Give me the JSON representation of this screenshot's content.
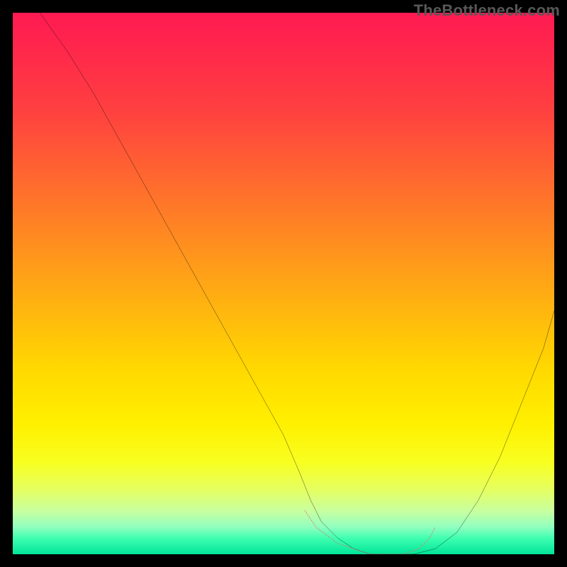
{
  "watermark": "TheBottleneck.com",
  "colors": {
    "background": "#000000",
    "curve_stroke": "#000000",
    "dot_fill": "#e0746d",
    "gradient_top": "#ff1a52",
    "gradient_mid": "#ffd900",
    "gradient_bottom": "#00e59a"
  },
  "chart_data": {
    "type": "line",
    "title": "",
    "xlabel": "",
    "ylabel": "",
    "xlim": [
      0,
      100
    ],
    "ylim": [
      0,
      100
    ],
    "grid": false,
    "legend": false,
    "series": [
      {
        "name": "bottleneck-curve",
        "x": [
          5,
          10,
          15,
          20,
          25,
          30,
          35,
          40,
          45,
          50,
          53,
          55,
          57,
          60,
          63,
          66,
          70,
          74,
          78,
          82,
          86,
          90,
          94,
          98,
          100
        ],
        "y": [
          100,
          93,
          85,
          76,
          67,
          58,
          49,
          40,
          31,
          22,
          15,
          10,
          6,
          3,
          1,
          0,
          0,
          0,
          1,
          4,
          10,
          18,
          28,
          38,
          45
        ]
      }
    ],
    "marker_points": {
      "name": "optimal-range-dots",
      "x": [
        54,
        56,
        60,
        63,
        66,
        69,
        72,
        75,
        77,
        78
      ],
      "y": [
        8,
        5,
        2,
        1,
        0,
        0,
        0,
        1,
        3,
        5
      ]
    },
    "notes": "V-shaped bottleneck curve on vertical red→yellow→green gradient. Minimum (best match) lies roughly at x≈66–72. Salmon dots mark the near-optimal flat region at the bottom of the V. Values are read off the chart; no numeric axes are shown, so x/y are normalized 0–100."
  }
}
